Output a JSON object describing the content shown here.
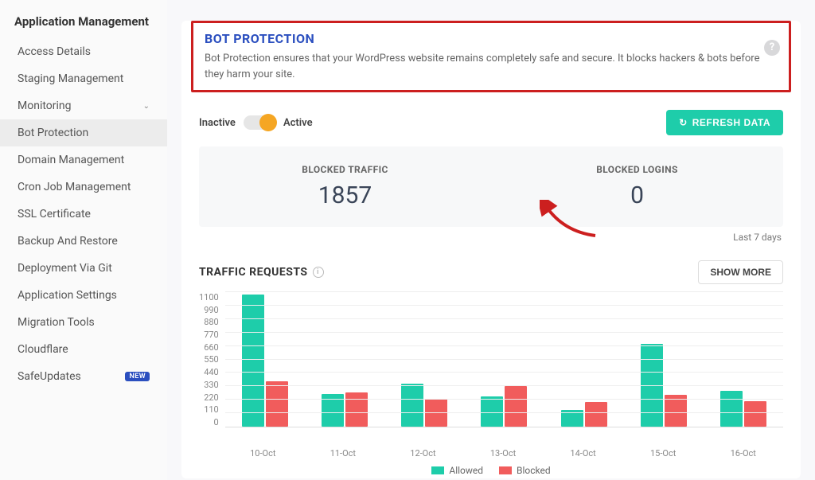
{
  "sidebar": {
    "title": "Application Management",
    "items": [
      {
        "label": "Access Details",
        "active": false
      },
      {
        "label": "Staging Management",
        "active": false
      },
      {
        "label": "Monitoring",
        "active": false,
        "expandable": true
      },
      {
        "label": "Bot Protection",
        "active": true
      },
      {
        "label": "Domain Management",
        "active": false
      },
      {
        "label": "Cron Job Management",
        "active": false
      },
      {
        "label": "SSL Certificate",
        "active": false
      },
      {
        "label": "Backup And Restore",
        "active": false
      },
      {
        "label": "Deployment Via Git",
        "active": false
      },
      {
        "label": "Application Settings",
        "active": false
      },
      {
        "label": "Migration Tools",
        "active": false
      },
      {
        "label": "Cloudflare",
        "active": false
      },
      {
        "label": "SafeUpdates",
        "active": false,
        "badge": "NEW"
      }
    ]
  },
  "header": {
    "title": "BOT PROTECTION",
    "description": "Bot Protection ensures that your WordPress website remains completely safe and secure. It blocks hackers & bots before they harm your site."
  },
  "toggle": {
    "inactive_label": "Inactive",
    "active_label": "Active",
    "state": "active"
  },
  "refresh_label": "REFRESH DATA",
  "stats": {
    "blocked_traffic_label": "BLOCKED TRAFFIC",
    "blocked_traffic_value": "1857",
    "blocked_logins_label": "BLOCKED LOGINS",
    "blocked_logins_value": "0",
    "period_label": "Last 7 days"
  },
  "chart_title": "TRAFFIC REQUESTS",
  "show_more_label": "SHOW MORE",
  "legend": {
    "allowed": "Allowed",
    "blocked": "Blocked"
  },
  "chart_data": {
    "type": "bar",
    "title": "TRAFFIC REQUESTS",
    "xlabel": "",
    "ylabel": "",
    "ylim": [
      0,
      1100
    ],
    "yticks": [
      0,
      110,
      220,
      330,
      440,
      550,
      660,
      770,
      880,
      990,
      1100
    ],
    "categories": [
      "10-Oct",
      "11-Oct",
      "12-Oct",
      "13-Oct",
      "14-Oct",
      "15-Oct",
      "16-Oct"
    ],
    "series": [
      {
        "name": "Allowed",
        "color": "#1ecdaa",
        "values": [
          1080,
          270,
          350,
          250,
          140,
          680,
          290
        ]
      },
      {
        "name": "Blocked",
        "color": "#f15c5c",
        "values": [
          370,
          280,
          230,
          330,
          200,
          260,
          210
        ]
      }
    ]
  }
}
